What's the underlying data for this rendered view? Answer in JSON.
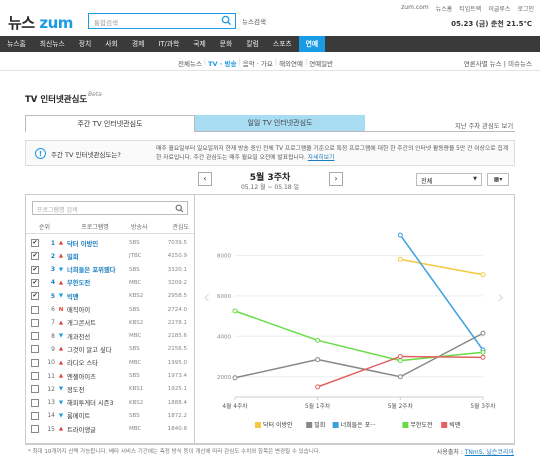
{
  "header": {
    "logo_text": "뉴스",
    "logo_brand": "zum",
    "search_placeholder": "통합검색",
    "search_label": "뉴스검색",
    "top_links": [
      "zum.com",
      "뉴스홈",
      "티임트랙",
      "이글루스",
      "로그인"
    ],
    "weather": "05.23 (금) 춘천 21.5℃"
  },
  "gnb": [
    "뉴스홈",
    "최신뉴스",
    "정치",
    "사회",
    "경제",
    "IT/과학",
    "국제",
    "문화",
    "칼럼",
    "스포츠",
    "연예"
  ],
  "gnb_active": "연예",
  "subnav": [
    {
      "label": "전체뉴스",
      "active": false
    },
    {
      "label": "TV · 방송",
      "active": true
    },
    {
      "label": "음악 · 가요",
      "active": false
    },
    {
      "label": "해외연예",
      "active": false
    },
    {
      "label": "연예일반",
      "active": false
    }
  ],
  "rightnav": "연론사별 뉴스 | 미슈뉴스",
  "page": {
    "title": "TV 인터넷관심도",
    "beta": "Beta",
    "tab_weekly": "주간 TV 인터넷관심도",
    "tab_weekly_hl": "주간",
    "tab_daily": "일일 TV 인터넷관심도",
    "tab_daily_hl": "일일",
    "tab_note": "지난 주차 관심도 보기"
  },
  "info": {
    "question": "주간 TV 인터넷관심도는?",
    "description": "매주 월요일부터 일요일까지 현재 방송 중인 전체 TV 프로그램을 기준으로 특정 프로그램에 대한 한 주간의 인터넷 활동량을 5만 건 이상으로 집계한 자료입니다. 주간 관심도는 매주 월요일 오전에 발표됩니다.",
    "more": "자세히보기"
  },
  "week": {
    "label": "5월 3주차",
    "range": "05.12 월 ~ 05.18 일",
    "select": "전체"
  },
  "program_search_placeholder": "프로그램명 검색",
  "table_headers": [
    "순위",
    "프로그램명",
    "방송사",
    "관심도"
  ],
  "programs": [
    {
      "rank": "1",
      "move": "up",
      "name": "닥터 이방인",
      "ch": "SBS",
      "score": "7039.5",
      "checked": true
    },
    {
      "rank": "2",
      "move": "up",
      "name": "밀회",
      "ch": "JTBC",
      "score": "4150.9",
      "checked": true
    },
    {
      "rank": "3",
      "move": "dn",
      "name": "너희들은 포위됐다",
      "ch": "SBS",
      "score": "3320.1",
      "checked": true
    },
    {
      "rank": "4",
      "move": "up",
      "name": "무한도전",
      "ch": "MBC",
      "score": "3209.2",
      "checked": true
    },
    {
      "rank": "5",
      "move": "dn",
      "name": "빅맨",
      "ch": "KBS2",
      "score": "2958.5",
      "checked": true
    },
    {
      "rank": "6",
      "move": "nw",
      "name": "매직아이",
      "ch": "SBS",
      "score": "2724.0",
      "checked": false
    },
    {
      "rank": "7",
      "move": "up",
      "name": "개그콘서트",
      "ch": "KBS2",
      "score": "2278.1",
      "checked": false
    },
    {
      "rank": "8",
      "move": "dn",
      "name": "개과천선",
      "ch": "MBC",
      "score": "2185.6",
      "checked": false
    },
    {
      "rank": "9",
      "move": "up",
      "name": "그것이 알고 싶다",
      "ch": "SBS",
      "score": "2156.5",
      "checked": false
    },
    {
      "rank": "10",
      "move": "up",
      "name": "라디오 스타",
      "ch": "MBC",
      "score": "1995.0",
      "checked": false
    },
    {
      "rank": "11",
      "move": "up",
      "name": "엔젤아이즈",
      "ch": "SBS",
      "score": "1973.4",
      "checked": false
    },
    {
      "rank": "12",
      "move": "dn",
      "name": "정도전",
      "ch": "KBS1",
      "score": "1925.1",
      "checked": false
    },
    {
      "rank": "13",
      "move": "dn",
      "name": "해피투게더 시즌3",
      "ch": "KBS2",
      "score": "1888.4",
      "checked": false
    },
    {
      "rank": "14",
      "move": "dn",
      "name": "룸메이트",
      "ch": "SBS",
      "score": "1872.2",
      "checked": false
    },
    {
      "rank": "15",
      "move": "up",
      "name": "트라이앵글",
      "ch": "MBC",
      "score": "1840.8",
      "checked": false
    }
  ],
  "chart_data": {
    "type": "line",
    "categories": [
      "4월 4주차",
      "5월 1주차",
      "5월 2주차",
      "5월 3주차"
    ],
    "ylim": [
      1000,
      9500
    ],
    "yticks": [
      "2000",
      "4000",
      "6000",
      "8000"
    ],
    "grid": true,
    "legend_position": "bottom",
    "series": [
      {
        "name": "닥터 이방인",
        "color": "#f5c842",
        "values": [
          null,
          null,
          7800,
          7039.5
        ]
      },
      {
        "name": "밀회",
        "color": "#888888",
        "values": [
          1950,
          2850,
          2000,
          4150.9
        ]
      },
      {
        "name": "너희들은 포···",
        "color": "#3aa0e0",
        "values": [
          null,
          null,
          9000,
          3320.1
        ]
      },
      {
        "name": "무한도전",
        "color": "#66dd44",
        "values": [
          5250,
          3800,
          2800,
          3209.2
        ]
      },
      {
        "name": "빅맨",
        "color": "#e26060",
        "values": [
          null,
          1500,
          3000,
          2958.5
        ]
      }
    ]
  },
  "footnote": "* 최대 10개까지 선택 가능합니다. 베타 서비스 기간에는 측정 방식 등이 개선에 따라 관심도 수치와 항목은 변경될 수 있습니다.",
  "source": {
    "label": "사용출처 : ",
    "link": "TNmS, 닐슨코리아"
  }
}
